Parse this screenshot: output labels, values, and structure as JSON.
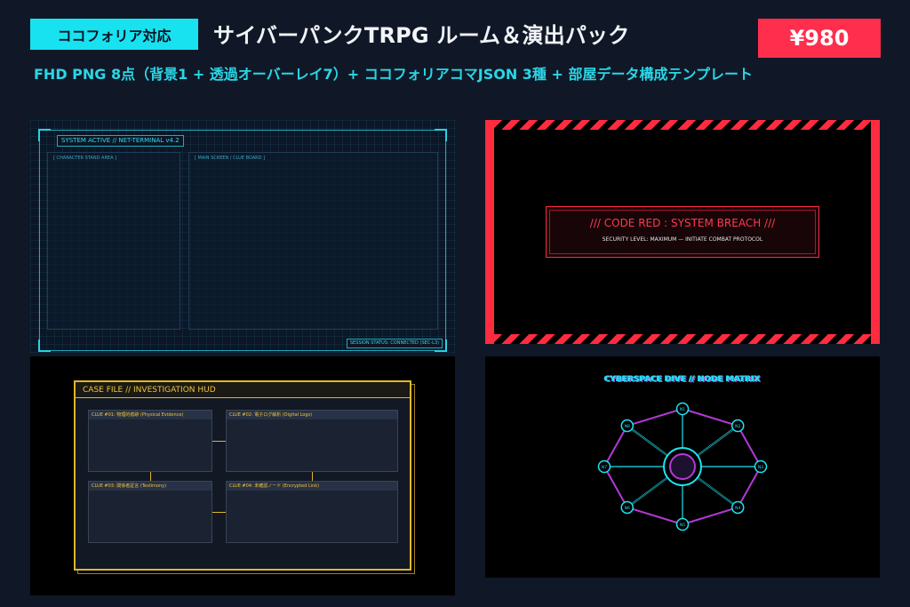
{
  "badge": "ココフォリア対応",
  "title": "サイバーパンクTRPG ルーム＆演出パック",
  "price": "¥980",
  "subtitle": "FHD PNG 8点（背景1 + 透過オーバーレイ7）+ ココフォリアコマJSON 3種 + 部屋データ構成テンプレート",
  "colors": {
    "cyan": "#18e2f0",
    "red": "#ff2e4d",
    "gold": "#e1b62a",
    "magenta": "#b23ad6",
    "bg": "#101827"
  },
  "panel_terminal": {
    "system_tag": "SYSTEM ACTIVE // NET-TERMINAL v4.2",
    "character_area": "[ CHARACTER STAND AREA ]",
    "main_area": "[ MAIN SCREEN / CLUE BOARD ]",
    "status": "SESSION STATUS: CONNECTED (SEC-L3)"
  },
  "panel_alert": {
    "title": "/// CODE RED : SYSTEM BREACH ///",
    "subtitle": "SECURITY LEVEL: MAXIMUM — INITIATE COMBAT PROTOCOL"
  },
  "panel_hud": {
    "header": "CASE FILE // INVESTIGATION HUD",
    "clues": [
      "CLUE #01: 物理的痕跡 (Physical Evidence)",
      "CLUE #02: 電子ログ解析 (Digital Logs)",
      "CLUE #03: 関係者証言 (Testimony)",
      "CLUE #04: 未確認ノード (Encrypted Link)"
    ]
  },
  "panel_network": {
    "title": "CYBERSPACE DIVE // NODE MATRIX",
    "node_labels": [
      "N1",
      "N2",
      "N3",
      "N4",
      "N5",
      "N6",
      "N7",
      "N8"
    ]
  }
}
